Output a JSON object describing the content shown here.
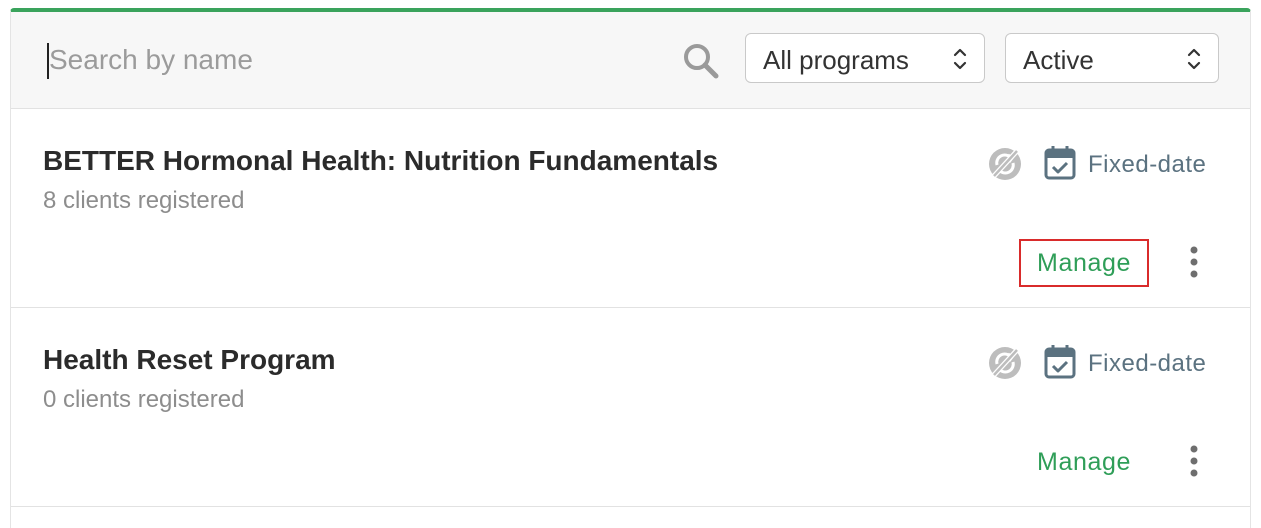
{
  "toolbar": {
    "search_placeholder": "Search by name",
    "search_icon": "search-icon",
    "program_filter": {
      "selected": "All programs"
    },
    "status_filter": {
      "selected": "Active"
    }
  },
  "programs": [
    {
      "title": "BETTER Hormonal Health: Nutrition Fundamentals",
      "clients": "8 clients registered",
      "type": "Fixed-date",
      "manage_label": "Manage",
      "highlighted": true
    },
    {
      "title": "Health Reset Program",
      "clients": "0 clients registered",
      "type": "Fixed-date",
      "manage_label": "Manage",
      "highlighted": false
    }
  ],
  "colors": {
    "accent": "#3aa35c",
    "manage_text": "#2f9e58",
    "highlight_border": "#d92b2b",
    "type_text": "#5b7280"
  }
}
